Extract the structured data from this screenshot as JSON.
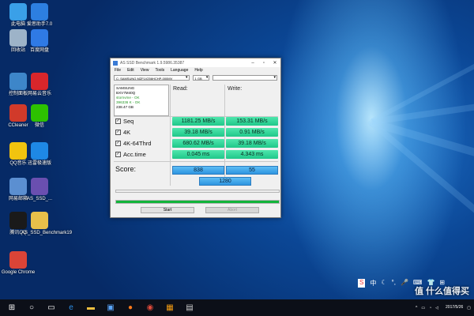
{
  "desktop_icons": [
    {
      "label": "此电脑",
      "icon": "computer-icon",
      "color": "#3aa0e8"
    },
    {
      "label": "爱思助手7.0",
      "icon": "i4-assistant-icon",
      "color": "#2d7fe0"
    },
    {
      "label": "回收站",
      "icon": "recycle-bin-icon",
      "color": "#9db3c8"
    },
    {
      "label": "百度网盘",
      "icon": "baidu-netdisk-icon",
      "color": "#2f7ae5"
    },
    {
      "label": "控制面板",
      "icon": "control-panel-icon",
      "color": "#3d86c9"
    },
    {
      "label": "网易云音乐",
      "icon": "netease-music-icon",
      "color": "#d8262b"
    },
    {
      "label": "CCleaner",
      "icon": "ccleaner-icon",
      "color": "#d13a2a"
    },
    {
      "label": "微信",
      "icon": "wechat-icon",
      "color": "#2dc100"
    },
    {
      "label": "QQ音乐",
      "icon": "qq-music-icon",
      "color": "#f1c40f"
    },
    {
      "label": "迅雷极速版",
      "icon": "thunder-icon",
      "color": "#1e88e5"
    },
    {
      "label": "网易邮箱",
      "icon": "netease-mail-icon",
      "color": "#5b8fd1"
    },
    {
      "label": "AS_SSD_...",
      "icon": "as-ssd-icon",
      "color": "#6a4fb0"
    },
    {
      "label": "腾讯QQ",
      "icon": "qq-icon",
      "color": "#1a1a1a"
    },
    {
      "label": "AS_SSD_Benchmark19",
      "icon": "zip-file-icon",
      "color": "#e8c04a"
    },
    {
      "label": "Google Chrome",
      "icon": "chrome-icon",
      "color": "#db4437"
    }
  ],
  "window": {
    "title": "AS SSD Benchmark 1.9.5986.35387",
    "menu": [
      "File",
      "Edit",
      "View",
      "Tools",
      "Language",
      "Help"
    ],
    "drive_select": "C: SAMSUNG MZFLV256HCHP-000MV",
    "size_select": "1 GB",
    "drive_info": {
      "model": "SAMSUNG",
      "firmware": "BXV7M40Q",
      "driver": "stornvme - OK",
      "alignment": "396336 K - OK",
      "capacity": "238.47 GB"
    },
    "col_read": "Read:",
    "col_write": "Write:",
    "rows": [
      {
        "label": "Seq",
        "read": "1181.25 MB/s",
        "write": "153.31 MB/s"
      },
      {
        "label": "4K",
        "read": "39.18 MB/s",
        "write": "0.91 MB/s"
      },
      {
        "label": "4K-64Thrd",
        "read": "680.62 MB/s",
        "write": "39.18 MB/s"
      },
      {
        "label": "Acc.time",
        "read": "0.045 ms",
        "write": "4.343 ms"
      }
    ],
    "score_label": "Score:",
    "score_read": "838",
    "score_write": "55",
    "score_total": "1280",
    "progress": 1.0,
    "start_label": "Start",
    "abort_label": "Abort"
  },
  "taskbar": {
    "clock_time": "",
    "clock_date": "2017/5/26",
    "tray_ime": "中",
    "watermark": "值 什么值得买"
  },
  "colors": {
    "result_green": "#2fd495",
    "score_blue": "#3aa6ea",
    "progress_green": "#12b43a"
  }
}
